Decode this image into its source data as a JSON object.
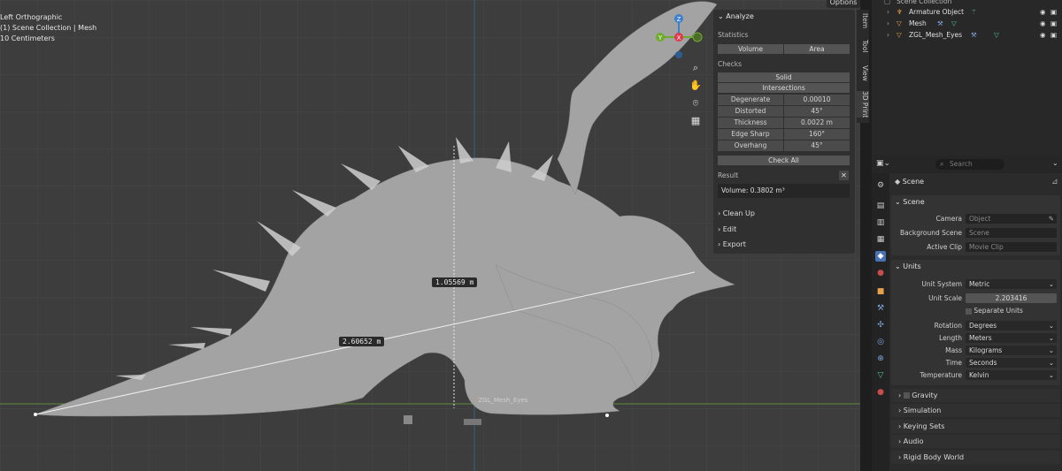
{
  "viewport": {
    "view_name": "Left Orthographic",
    "collection_path": "(1) Scene Collection | Mesh",
    "scale_text": "10 Centimeters",
    "options_label": "Options",
    "measure_vertical": "1.05569 m",
    "measure_diag": "2.60652 m",
    "object_label": "ZGL_Mesh_Eyes",
    "gizmo": {
      "z": "Z",
      "y": "Y",
      "x": "X"
    }
  },
  "npanel": {
    "title": "Analyze",
    "statistics_label": "Statistics",
    "volume_btn": "Volume",
    "area_btn": "Area",
    "checks_label": "Checks",
    "solid_btn": "Solid",
    "intersections_btn": "Intersections",
    "rows": [
      {
        "k": "Degenerate",
        "v": "0.00010"
      },
      {
        "k": "Distorted",
        "v": "45°"
      },
      {
        "k": "Thickness",
        "v": "0.0022 m"
      },
      {
        "k": "Edge Sharp",
        "v": "160°"
      },
      {
        "k": "Overhang",
        "v": "45°"
      }
    ],
    "check_all_btn": "Check All",
    "result_label": "Result",
    "result_value": "Volume: 0.3802 m³",
    "folds": [
      "Clean Up",
      "Edit",
      "Export"
    ]
  },
  "side_tabs": [
    "Item",
    "Tool",
    "View",
    "3D Print"
  ],
  "outliner": {
    "root": "Scene Collection",
    "items": [
      {
        "label": "Armature Object"
      },
      {
        "label": "Mesh"
      },
      {
        "label": "ZGL_Mesh_Eyes"
      }
    ]
  },
  "properties": {
    "search_placeholder": "Search",
    "context_title": "Scene",
    "scene_panel": {
      "title": "Scene",
      "camera_label": "Camera",
      "camera_placeholder": "Object",
      "background_label": "Background Scene",
      "background_placeholder": "Scene",
      "clip_label": "Active Clip",
      "clip_placeholder": "Movie Clip"
    },
    "units_panel": {
      "title": "Units",
      "unit_system_label": "Unit System",
      "unit_system_value": "Metric",
      "unit_scale_label": "Unit Scale",
      "unit_scale_value": "2.203416",
      "separate_units_label": "Separate Units",
      "rotation_label": "Rotation",
      "rotation_value": "Degrees",
      "length_label": "Length",
      "length_value": "Meters",
      "mass_label": "Mass",
      "mass_value": "Kilograms",
      "time_label": "Time",
      "time_value": "Seconds",
      "temperature_label": "Temperature",
      "temperature_value": "Kelvin"
    },
    "collapsed": [
      "Gravity",
      "Simulation",
      "Keying Sets",
      "Audio",
      "Rigid Body World"
    ]
  },
  "colors": {
    "accent": "#4772b3",
    "x_axis": "#e0394b",
    "y_axis": "#6fac2e",
    "z_axis": "#3b7fd1",
    "horizon": "#5f8a3a"
  }
}
